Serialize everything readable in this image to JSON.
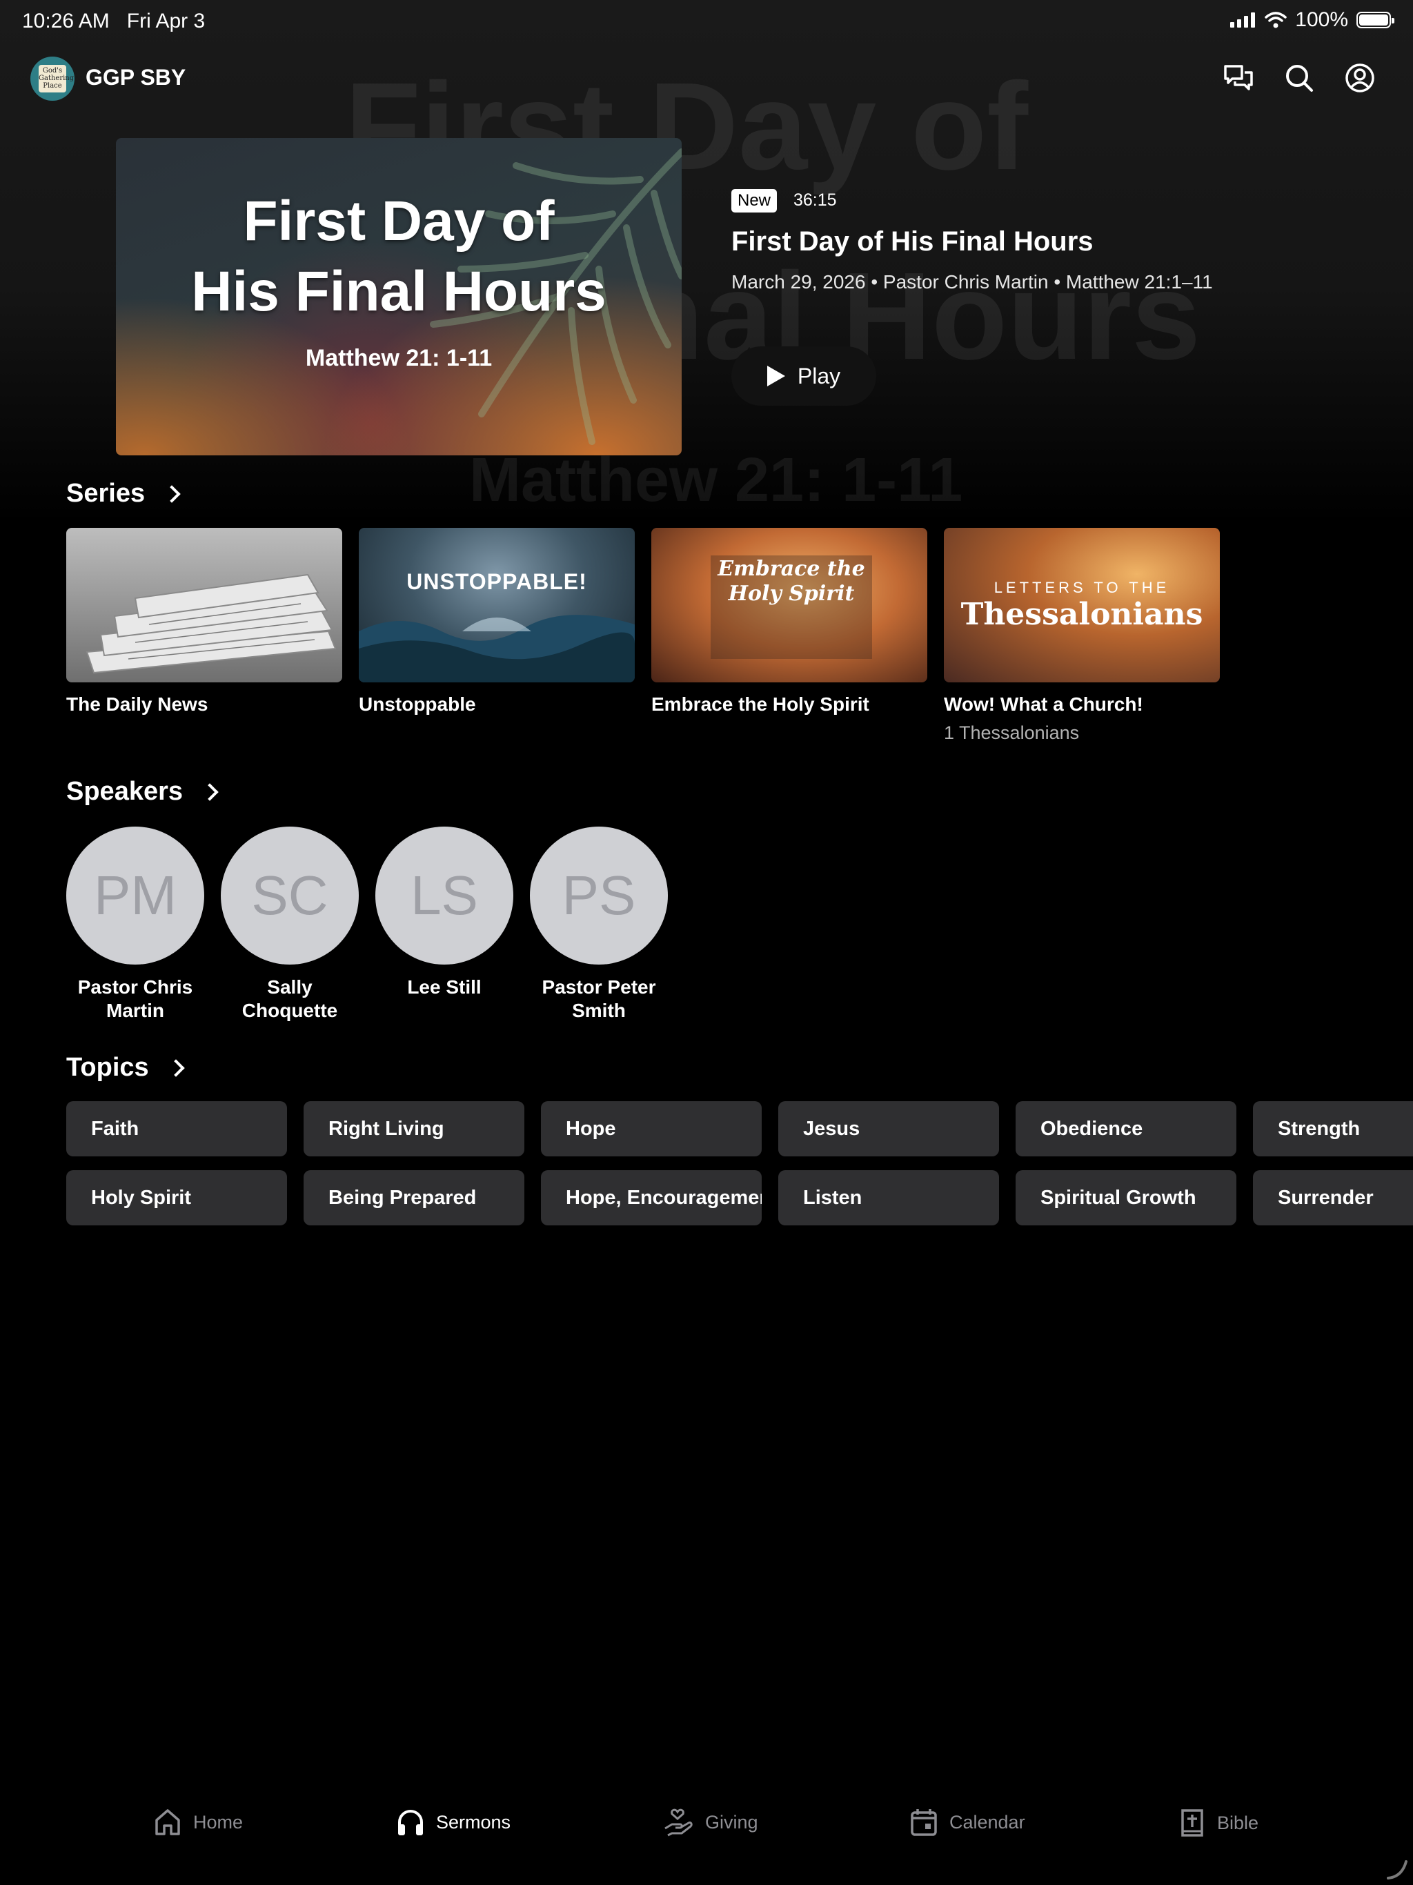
{
  "status": {
    "time": "10:26 AM",
    "date": "Fri Apr 3",
    "battery": "100%"
  },
  "header": {
    "app_title": "GGP SBY",
    "logo_text": "God's Gathering Place"
  },
  "featured": {
    "art_title_line1": "First Day of",
    "art_title_line2": "His Final Hours",
    "art_subtitle": "Matthew 21: 1-11",
    "badge": "New",
    "duration": "36:15",
    "title": "First Day of His Final Hours",
    "meta": "March 29, 2026 • Pastor Chris Martin • Matthew 21:1–11",
    "play_label": "Play"
  },
  "series": {
    "heading": "Series",
    "items": [
      {
        "name": "The Daily News",
        "sub": ""
      },
      {
        "name": "Unstoppable",
        "sub": "",
        "art_text": "UNSTOPPABLE!"
      },
      {
        "name": "Embrace  the Holy Spirit",
        "sub": "",
        "art_text": "Embrace the Holy Spirit"
      },
      {
        "name": "Wow! What a Church!",
        "sub": "1 Thessalonians",
        "art_top": "LETTERS TO THE",
        "art_text": "Thessalonians"
      }
    ]
  },
  "speakers": {
    "heading": "Speakers",
    "items": [
      {
        "initials": "PM",
        "name": "Pastor Chris Martin"
      },
      {
        "initials": "SC",
        "name": "Sally Choquette"
      },
      {
        "initials": "LS",
        "name": "Lee Still"
      },
      {
        "initials": "PS",
        "name": "Pastor Peter Smith"
      }
    ]
  },
  "topics": {
    "heading": "Topics",
    "row1": [
      "Faith",
      "Right Living",
      "Hope",
      "Jesus",
      "Obedience",
      "Strength"
    ],
    "row2": [
      "Holy Spirit",
      "Being Prepared",
      "Hope, Encouragement",
      "Listen",
      "Spiritual Growth",
      "Surrender"
    ]
  },
  "tabs": [
    {
      "label": "Home",
      "icon": "home-icon"
    },
    {
      "label": "Sermons",
      "icon": "headphones-icon",
      "active": true
    },
    {
      "label": "Giving",
      "icon": "giving-hand-icon"
    },
    {
      "label": "Calendar",
      "icon": "calendar-icon"
    },
    {
      "label": "Bible",
      "icon": "bible-icon"
    }
  ]
}
